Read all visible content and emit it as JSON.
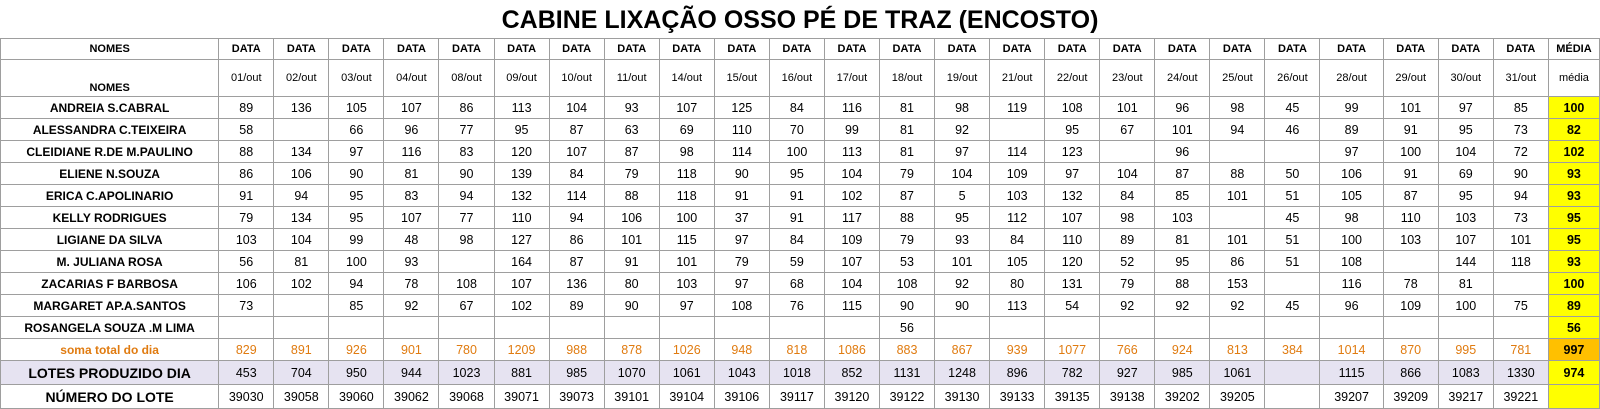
{
  "title": "CABINE LIXAÇÃO OSSO PÉ DE TRAZ (ENCOSTO)",
  "header": {
    "names_label": "NOMES",
    "data_label": "DATA",
    "media_label": "MÉDIA",
    "names_label_2": "NOMES",
    "media_label_2": "média",
    "dates": [
      "01/out",
      "02/out",
      "03/out",
      "04/out",
      "08/out",
      "09/out",
      "10/out",
      "11/out",
      "14/out",
      "15/out",
      "16/out",
      "17/out",
      "18/out",
      "19/out",
      "21/out",
      "22/out",
      "23/out",
      "24/out",
      "25/out",
      "26/out",
      "28/out",
      "29/out",
      "30/out",
      "31/out"
    ]
  },
  "rows": [
    {
      "name": "ANDREIA S.CABRAL",
      "values": [
        "89",
        "136",
        "105",
        "107",
        "86",
        "113",
        "104",
        "93",
        "107",
        "125",
        "84",
        "116",
        "81",
        "98",
        "119",
        "108",
        "101",
        "96",
        "98",
        "45",
        "99",
        "101",
        "97",
        "85"
      ],
      "media": "100"
    },
    {
      "name": "ALESSANDRA C.TEIXEIRA",
      "values": [
        "58",
        "",
        "66",
        "96",
        "77",
        "95",
        "87",
        "63",
        "69",
        "110",
        "70",
        "99",
        "81",
        "92",
        "",
        "95",
        "67",
        "101",
        "94",
        "46",
        "89",
        "91",
        "95",
        "73"
      ],
      "media": "82"
    },
    {
      "name": "CLEIDIANE R.DE M.PAULINO",
      "values": [
        "88",
        "134",
        "97",
        "116",
        "83",
        "120",
        "107",
        "87",
        "98",
        "114",
        "100",
        "113",
        "81",
        "97",
        "114",
        "123",
        "",
        "96",
        "",
        "",
        "97",
        "100",
        "104",
        "72"
      ],
      "media": "102"
    },
    {
      "name": "ELIENE N.SOUZA",
      "values": [
        "86",
        "106",
        "90",
        "81",
        "90",
        "139",
        "84",
        "79",
        "118",
        "90",
        "95",
        "104",
        "79",
        "104",
        "109",
        "97",
        "104",
        "87",
        "88",
        "50",
        "106",
        "91",
        "69",
        "90"
      ],
      "media": "93"
    },
    {
      "name": "ERICA C.APOLINARIO",
      "values": [
        "91",
        "94",
        "95",
        "83",
        "94",
        "132",
        "114",
        "88",
        "118",
        "91",
        "91",
        "102",
        "87",
        "5",
        "103",
        "132",
        "84",
        "85",
        "101",
        "51",
        "105",
        "87",
        "95",
        "94"
      ],
      "media": "93"
    },
    {
      "name": "KELLY RODRIGUES",
      "values": [
        "79",
        "134",
        "95",
        "107",
        "77",
        "110",
        "94",
        "106",
        "100",
        "37",
        "91",
        "117",
        "88",
        "95",
        "112",
        "107",
        "98",
        "103",
        "",
        "45",
        "98",
        "110",
        "103",
        "73"
      ],
      "media": "95"
    },
    {
      "name": "LIGIANE DA SILVA",
      "values": [
        "103",
        "104",
        "99",
        "48",
        "98",
        "127",
        "86",
        "101",
        "115",
        "97",
        "84",
        "109",
        "79",
        "93",
        "84",
        "110",
        "89",
        "81",
        "101",
        "51",
        "100",
        "103",
        "107",
        "101"
      ],
      "media": "95"
    },
    {
      "name": "M. JULIANA ROSA",
      "values": [
        "56",
        "81",
        "100",
        "93",
        "",
        "164",
        "87",
        "91",
        "101",
        "79",
        "59",
        "107",
        "53",
        "101",
        "105",
        "120",
        "52",
        "95",
        "86",
        "51",
        "108",
        "",
        "144",
        "118"
      ],
      "media": "93"
    },
    {
      "name": "ZACARIAS F BARBOSA",
      "values": [
        "106",
        "102",
        "94",
        "78",
        "108",
        "107",
        "136",
        "80",
        "103",
        "97",
        "68",
        "104",
        "108",
        "92",
        "80",
        "131",
        "79",
        "88",
        "153",
        "",
        "116",
        "78",
        "81",
        ""
      ],
      "media": "100"
    },
    {
      "name": "MARGARET AP.A.SANTOS",
      "values": [
        "73",
        "",
        "85",
        "92",
        "67",
        "102",
        "89",
        "90",
        "97",
        "108",
        "76",
        "115",
        "90",
        "90",
        "113",
        "54",
        "92",
        "92",
        "92",
        "45",
        "96",
        "109",
        "100",
        "75"
      ],
      "media": "89"
    },
    {
      "name": "ROSANGELA SOUZA .M LIMA",
      "values": [
        "",
        "",
        "",
        "",
        "",
        "",
        "",
        "",
        "",
        "",
        "",
        "",
        "56",
        "",
        "",
        "",
        "",
        "",
        "",
        "",
        "",
        "",
        "",
        ""
      ],
      "media": "56"
    }
  ],
  "soma": {
    "label": "soma total  do dia",
    "values": [
      "829",
      "891",
      "926",
      "901",
      "780",
      "1209",
      "988",
      "878",
      "1026",
      "948",
      "818",
      "1086",
      "883",
      "867",
      "939",
      "1077",
      "766",
      "924",
      "813",
      "384",
      "1014",
      "870",
      "995",
      "781"
    ],
    "media": "997"
  },
  "lotes": {
    "label": "LOTES PRODUZIDO DIA",
    "values": [
      "453",
      "704",
      "950",
      "944",
      "1023",
      "881",
      "985",
      "1070",
      "1061",
      "1043",
      "1018",
      "852",
      "1131",
      "1248",
      "896",
      "782",
      "927",
      "985",
      "1061",
      "",
      "1115",
      "866",
      "1083",
      "1330"
    ],
    "media": "974"
  },
  "numero": {
    "label": "NÚMERO DO LOTE",
    "values": [
      "39030",
      "39058",
      "39060",
      "39062",
      "39068",
      "39071",
      "39073",
      "39101",
      "39104",
      "39106",
      "39117",
      "39120",
      "39122",
      "39130",
      "39133",
      "39135",
      "39138",
      "39202",
      "39205",
      "",
      "39207",
      "39209",
      "39217",
      "39221"
    ],
    "media": ""
  }
}
